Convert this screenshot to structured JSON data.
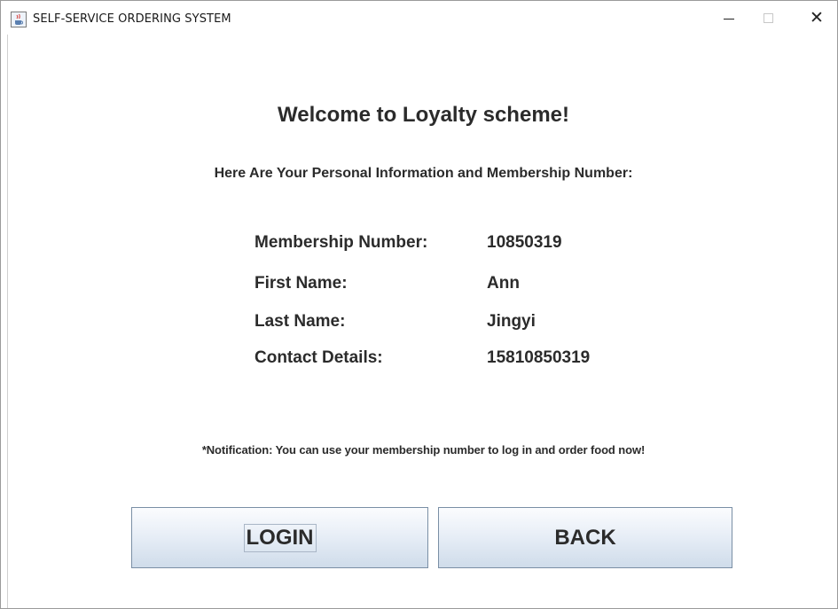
{
  "window": {
    "title": "SELF-SERVICE ORDERING SYSTEM",
    "icon": "java-cup-icon",
    "controls": {
      "minimize_glyph": "",
      "close_glyph": "✕"
    }
  },
  "main": {
    "welcome": "Welcome to Loyalty scheme!",
    "subtitle": "Here Are Your Personal Information and Membership Number:",
    "info": [
      {
        "label": "Membership Number:",
        "value": "10850319"
      },
      {
        "label": "First Name:",
        "value": "Ann"
      },
      {
        "label": "Last Name:",
        "value": "Jingyi"
      },
      {
        "label": "Contact Details:",
        "value": "15810850319"
      }
    ],
    "notification": "*Notification: You can use your membership number to log in and order food now!"
  },
  "buttons": {
    "login_label": "LOGIN",
    "back_label": "BACK"
  },
  "colors": {
    "text": "#2b2b2b",
    "button_top": "#fbfcfe",
    "button_bottom": "#cfdcea",
    "button_border": "#7a8fa5"
  }
}
